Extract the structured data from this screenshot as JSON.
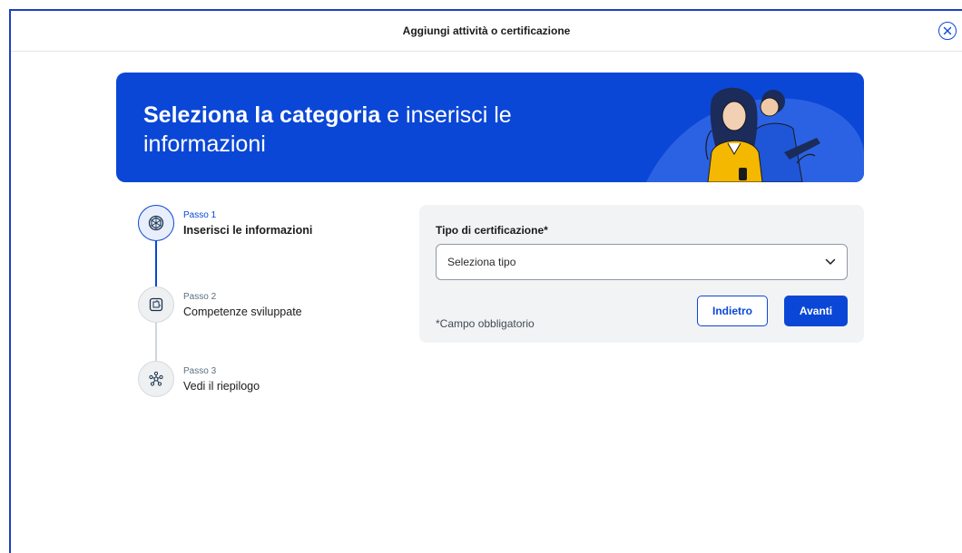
{
  "modal": {
    "title": "Aggiungi attività o certificazione",
    "close_icon": "close-circle-icon"
  },
  "banner": {
    "title_bold": "Seleziona la categoria",
    "title_rest": " e inserisci le informazioni",
    "illustration": "two-people-with-laptop-and-phone"
  },
  "stepper": {
    "steps": [
      {
        "kicker": "Passo 1",
        "label": "Inserisci le informazioni",
        "icon": "cube-icon",
        "state": "active"
      },
      {
        "kicker": "Passo 2",
        "label": "Competenze sviluppate",
        "icon": "puzzle-icon",
        "state": "inactive"
      },
      {
        "kicker": "Passo 3",
        "label": "Vedi il riepilogo",
        "icon": "network-icon",
        "state": "inactive"
      }
    ]
  },
  "form": {
    "field_label": "Tipo di certificazione*",
    "select_value": "Seleziona tipo",
    "required_note": "*Campo obbligatorio",
    "back_label": "Indietro",
    "next_label": "Avanti"
  },
  "colors": {
    "primary": "#0b47d6",
    "panel_bg": "#f2f3f5",
    "text": "#1b1b1b"
  }
}
